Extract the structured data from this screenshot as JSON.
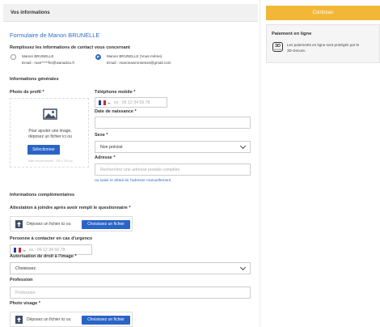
{
  "header": {
    "title": "Vos informations"
  },
  "continue_button": "Continuer",
  "payment": {
    "title": "Paiement en ligne",
    "badge": "3D",
    "badge_sub": "SECURE",
    "text_line1": "Les paiements en ligne sont protégés par le",
    "text_line2": "3D-Secure."
  },
  "form": {
    "title": "Formulaire de Manon BRUNELLE",
    "contact_prompt": "Remplissez les informations de contact vous concernant",
    "contacts": [
      {
        "name": "Manon BRUNELLE",
        "email": "Email : man*****lle@wanadoo.fr",
        "selected": false
      },
      {
        "name": "Manon BRUNELLE (Vous-même)",
        "email": "Email : manonavironsetois@gmail.com",
        "selected": true
      }
    ],
    "general_title": "Informations générales",
    "photo_label": "Photo de profil *",
    "photo_text_1": "Pour ajouter une image,",
    "photo_text_2": "déposez un fichier ici ou",
    "photo_button": "Sélectionner",
    "photo_hint": "Taille recommandée : 200 x 200 px",
    "phone_label": "Téléphone mobile *",
    "phone_placeholder": "ex : 06 12 34 56 78",
    "birth_label": "Date de naissance *",
    "sex_label": "Sexe *",
    "sex_value": "Non précisé",
    "address_label": "Adresse *",
    "address_placeholder": "Recherchez une adresse postale complète",
    "address_link": "ou saisir le détail de l'adresse manuellement",
    "complementary_title": "Informations complémentaires",
    "attestation_label": "Attestation à joindre après avoir rempli le questionnaire *",
    "drop_text": "Déposez un fichier ici ou",
    "choose_file": "Choisissez un fichier",
    "emergency_label": "Personne à contacter en cas d'urgence",
    "emergency_placeholder": "ex : 06 12 34 56 78",
    "image_rights_label": "Autorisation de droit à l'image *",
    "image_rights_value": "Choisissez",
    "profession_label": "Profession",
    "profession_placeholder": "Profession",
    "face_photo_label": "Photo visage *",
    "drop_text_2": "Déposez un fichier ici ou",
    "choose_file_2": "Choisissez un fichier"
  },
  "colors": {
    "accent_blue": "#2a64c7",
    "continue_orange": "#f2b736",
    "link_blue": "#2f6fc4"
  },
  "icons": [
    "image-icon",
    "upload-icon",
    "chevron-down-icon",
    "french-flag-icon",
    "3d-secure-icon"
  ]
}
